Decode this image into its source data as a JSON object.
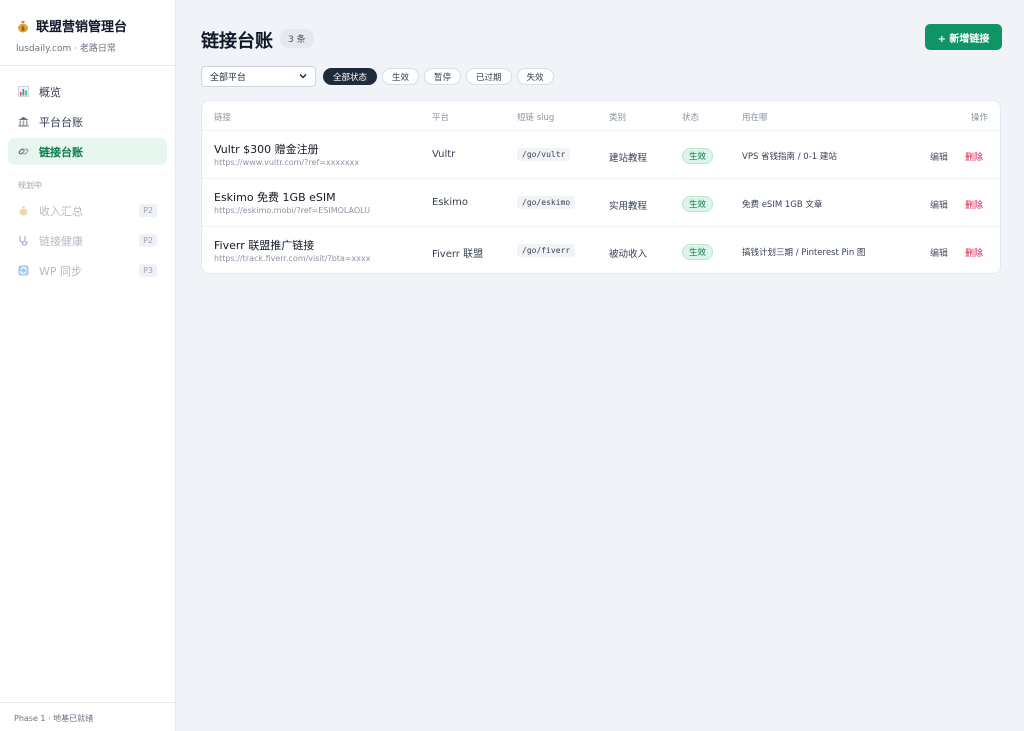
{
  "brand": {
    "title": "联盟营销管理台",
    "subtitle": "lusdaily.com · 老路日常",
    "icon": "money-bag-icon"
  },
  "nav": {
    "items": [
      {
        "label": "概览",
        "icon": "bar-chart-icon"
      },
      {
        "label": "平台台账",
        "icon": "bank-icon"
      },
      {
        "label": "链接台账",
        "icon": "link-icon",
        "active": true
      }
    ],
    "section_label": "规划中",
    "planned": [
      {
        "label": "收入汇总",
        "icon": "money-bag-icon",
        "badge": "P2"
      },
      {
        "label": "链接健康",
        "icon": "stethoscope-icon",
        "badge": "P2"
      },
      {
        "label": "WP 同步",
        "icon": "sync-icon",
        "badge": "P3"
      }
    ]
  },
  "footer": {
    "text": "Phase 1 · 地基已就绪"
  },
  "page": {
    "title": "链接台账",
    "count": "3 条",
    "add_button": "+ 新增链接"
  },
  "filters": {
    "platform_select": "全部平台",
    "chips": [
      "全部状态",
      "生效",
      "暂停",
      "已过期",
      "失效"
    ],
    "active_chip": "全部状态"
  },
  "table": {
    "headers": {
      "link": "链接",
      "platform": "平台",
      "slug": "短链 slug",
      "category": "类别",
      "status": "状态",
      "used_in": "用在哪",
      "actions": "操作"
    },
    "rows": [
      {
        "name": "Vultr $300 赠金注册",
        "url": "https://www.vultr.com/?ref=xxxxxxx",
        "platform": "Vultr",
        "slug": "/go/vultr",
        "category": "建站教程",
        "status": "生效",
        "used_in": "VPS 省钱指南 / 0-1 建站",
        "edit": "编辑",
        "delete": "删除"
      },
      {
        "name": "Eskimo 免费 1GB eSIM",
        "url": "https://eskimo.mobi/?ref=ESIMOLAOLU",
        "platform": "Eskimo",
        "slug": "/go/eskimo",
        "category": "实用教程",
        "status": "生效",
        "used_in": "免费 eSIM 1GB 文章",
        "edit": "编辑",
        "delete": "删除"
      },
      {
        "name": "Fiverr 联盟推广链接",
        "url": "https://track.fiverr.com/visit/?bta=xxxx",
        "platform": "Fiverr 联盟",
        "slug": "/go/fiverr",
        "category": "被动收入",
        "status": "生效",
        "used_in": "搞钱计划三期 / Pinterest Pin 图",
        "edit": "编辑",
        "delete": "删除"
      }
    ]
  },
  "colors": {
    "accent": "#109466",
    "active_nav_bg": "#e7f6ef",
    "active_chip": "#1f2a3a",
    "danger": "#e11d48",
    "status_green": "#0f7a52"
  }
}
